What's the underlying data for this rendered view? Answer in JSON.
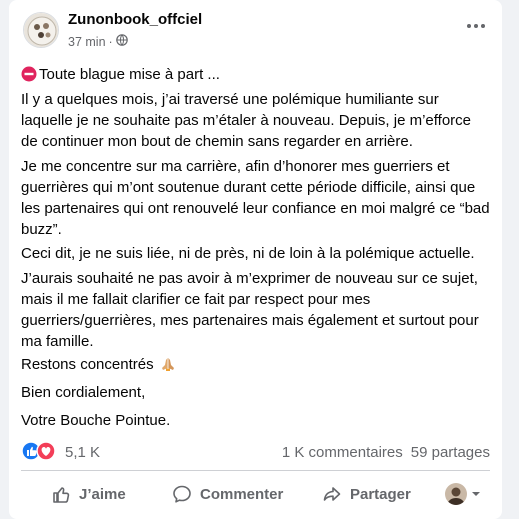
{
  "post": {
    "author": "Zunonbook_offciel",
    "time": "37 min",
    "dot": "·",
    "paragraphs": [
      "Toute blague mise à part ...",
      "Il y a quelques mois, j’ai traversé une polémique humiliante sur laquelle je ne souhaite pas m’étaler à nouveau. Depuis, je m’efforce de continuer mon bout de chemin sans regarder en arrière.",
      "Je me concentre sur ma carrière, afin d’honorer mes guerriers et guerrières qui m’ont soutenue durant cette période difficile,  ainsi que les partenaires qui ont renouvelé leur confiance en moi malgré ce “bad buzz”.",
      "Ceci dit, je ne suis liée, ni de près, ni de loin à la polémique actuelle.",
      "J’aurais souhaité ne pas avoir à m’exprimer de nouveau sur ce sujet, mais il me fallait clarifier ce fait par respect pour mes guerriers/guerrières, mes partenaires mais également et surtout pour ma famille.",
      "Restons concentrés",
      "Bien cordialement,",
      "Votre Bouche Pointue."
    ]
  },
  "stats": {
    "reactions_count": "5,1 K",
    "comments": "1 K commentaires",
    "shares": "59 partages"
  },
  "actions": {
    "like": "J’aime",
    "comment": "Commenter",
    "share": "Partager"
  },
  "icons": {
    "no_entry": "no-entry-icon",
    "praying_hands": "praying-hands-icon",
    "globe": "globe-icon",
    "more": "more-dots-icon"
  },
  "colors": {
    "like_blue": "#1877f2",
    "love_red": "#f33e58",
    "secondary_text": "#65676b"
  }
}
